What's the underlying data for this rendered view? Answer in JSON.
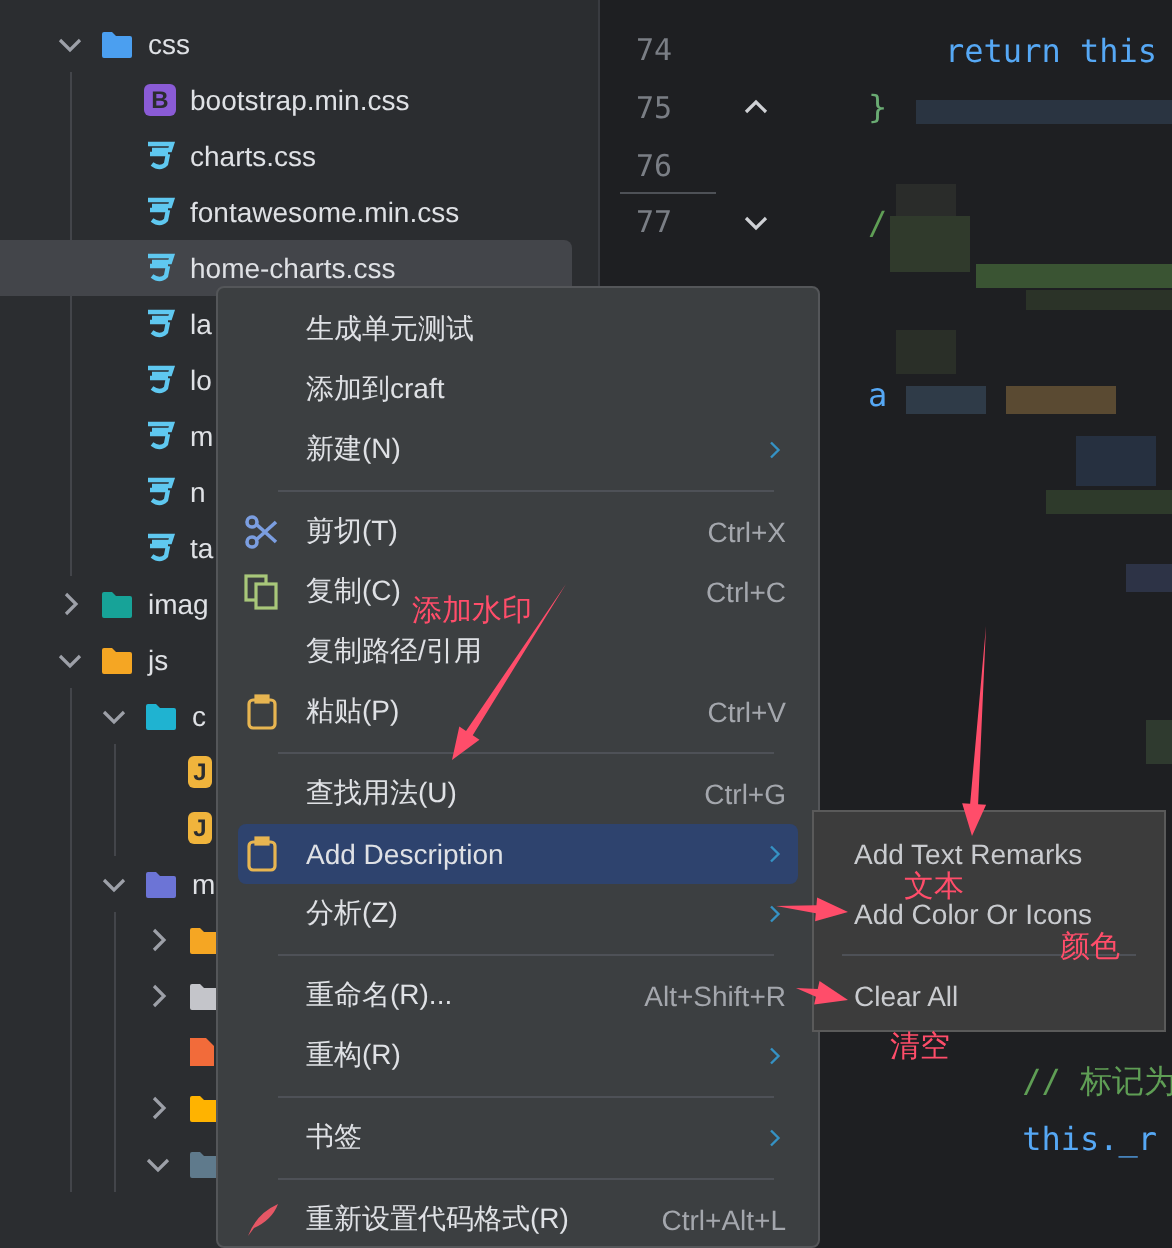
{
  "project_tree": {
    "items": [
      {
        "kind": "folder",
        "label": "css",
        "color": "#4b9ff0",
        "expanded": true,
        "selected": false,
        "children": [
          {
            "kind": "badge-file",
            "badge": "B",
            "label": "bootstrap.min.css",
            "selected": false
          },
          {
            "kind": "css-file",
            "label": "charts.css",
            "selected": false
          },
          {
            "kind": "css-file",
            "label": "fontawesome.min.css",
            "selected": false
          },
          {
            "kind": "css-file",
            "label": "home-charts.css",
            "selected": true
          },
          {
            "kind": "css-file",
            "label": "la",
            "selected": false
          },
          {
            "kind": "css-file",
            "label": "lo",
            "selected": false
          },
          {
            "kind": "css-file",
            "label": "m",
            "selected": false
          },
          {
            "kind": "css-file",
            "label": "n",
            "selected": false
          },
          {
            "kind": "css-file",
            "label": "ta",
            "selected": false
          }
        ]
      },
      {
        "kind": "folder",
        "label": "imag",
        "color": "#17a398",
        "expanded": false,
        "selected": false
      },
      {
        "kind": "folder",
        "label": "js",
        "color": "#f5a623",
        "expanded": true,
        "selected": false,
        "children": [
          {
            "kind": "folder",
            "label": "c",
            "color": "#1fb3d1",
            "expanded": true,
            "selected": false,
            "children": [
              {
                "kind": "badge-file",
                "badge": "J",
                "selected": false
              },
              {
                "kind": "badge-file",
                "badge": "J",
                "selected": false
              }
            ]
          },
          {
            "kind": "folder",
            "label": "m",
            "color": "#6c74d6",
            "expanded": true,
            "selected": false,
            "children": [
              {
                "kind": "folder",
                "color": "#f5a623",
                "expanded": false,
                "selected": false
              },
              {
                "kind": "folder",
                "color": "#c4c5ca",
                "expanded": false,
                "selected": false
              },
              {
                "kind": "file",
                "color": "#f26b3a",
                "selected": false
              },
              {
                "kind": "folder",
                "color": "#ffb300",
                "expanded": false,
                "selected": false
              },
              {
                "kind": "folder",
                "color": "#5f7a8c",
                "expanded": true,
                "selected": false
              }
            ]
          }
        ]
      }
    ]
  },
  "editor": {
    "lines": [
      {
        "number": "74",
        "fold": false,
        "kind": "keyword",
        "code": "    return this"
      },
      {
        "number": "75",
        "fold": true,
        "block_start": false,
        "kind": "brace",
        "code": "}"
      },
      {
        "number": "76",
        "fold": false
      },
      {
        "number": "77",
        "fold": true,
        "block_start": true,
        "kind": "comment",
        "code": "/"
      },
      {
        "kind": "keyword",
        "code": "a"
      },
      {
        "kind": "comment",
        "code": "        // 标记为"
      },
      {
        "kind": "keyword",
        "code": "        this._r"
      }
    ]
  },
  "context_menu": {
    "items": [
      {
        "kind": "plain",
        "label": "生成单元测试",
        "submenu": false,
        "selected": false
      },
      {
        "kind": "plain",
        "label": "添加到craft",
        "submenu": false,
        "selected": false
      },
      {
        "kind": "plain",
        "label": "新建(N)",
        "submenu": true,
        "selected": false
      },
      {
        "kind": "separator"
      },
      {
        "kind": "cut",
        "label": "剪切(T)",
        "shortcut": "Ctrl+X",
        "submenu": false,
        "selected": false
      },
      {
        "kind": "copy",
        "label": "复制(C)",
        "shortcut": "Ctrl+C",
        "submenu": false,
        "selected": false
      },
      {
        "kind": "plain",
        "label": "复制路径/引用",
        "submenu": false,
        "selected": false
      },
      {
        "kind": "paste",
        "label": "粘贴(P)",
        "shortcut": "Ctrl+V",
        "submenu": false,
        "selected": false
      },
      {
        "kind": "separator"
      },
      {
        "kind": "plain",
        "label": "查找用法(U)",
        "shortcut": "Ctrl+G",
        "submenu": false,
        "selected": false
      },
      {
        "kind": "paste",
        "label": "Add Description",
        "submenu": true,
        "selected": true
      },
      {
        "kind": "plain",
        "label": "分析(Z)",
        "submenu": true,
        "selected": false
      },
      {
        "kind": "separator"
      },
      {
        "kind": "plain",
        "label": "重命名(R)...",
        "shortcut": "Alt+Shift+R",
        "submenu": false,
        "selected": false
      },
      {
        "kind": "plain",
        "label": "重构(R)",
        "submenu": true,
        "selected": false
      },
      {
        "kind": "separator"
      },
      {
        "kind": "plain",
        "label": "书签",
        "submenu": true,
        "selected": false
      },
      {
        "kind": "separator"
      },
      {
        "kind": "format",
        "label": "重新设置代码格式(R)",
        "shortcut": "Ctrl+Alt+L",
        "submenu": false,
        "selected": false
      }
    ]
  },
  "submenu": {
    "items": [
      {
        "kind": "item",
        "label": "Add Text Remarks"
      },
      {
        "kind": "item",
        "label": "Add Color Or Icons"
      },
      {
        "kind": "separator"
      },
      {
        "kind": "item",
        "label": "Clear All"
      }
    ]
  },
  "annotations": [
    {
      "text": "添加水印"
    },
    {
      "text": "文本"
    },
    {
      "text": "颜色"
    },
    {
      "text": "清空"
    }
  ]
}
